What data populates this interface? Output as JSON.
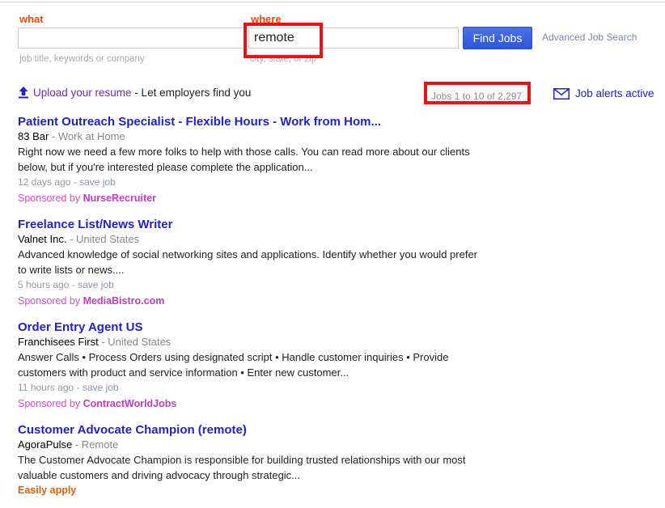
{
  "search": {
    "what_label": "what",
    "where_label": "where",
    "what_value": "",
    "what_placeholder": "",
    "where_value": "remote",
    "where_placeholder": "",
    "what_hint": "job title, keywords or company",
    "where_hint": "city, state, or zip",
    "find_jobs_label": "Find Jobs",
    "advanced_search_label": "Advanced Job Search"
  },
  "utility": {
    "upload_link": "Upload your resume",
    "upload_tail": " - Let employers find you",
    "job_count": "Jobs 1 to 10 of 2,297",
    "alerts_label": "Job alerts active"
  },
  "annotations": {
    "color": "#ee1111",
    "boxes": [
      "where-input",
      "job-count"
    ]
  },
  "results": [
    {
      "title": "Patient Outreach Specialist - Flexible Hours - Work from Hom...",
      "company": "83 Bar",
      "separator": " - ",
      "location": "Work at Home",
      "summary": "Right now we need a few more folks to help with those calls. You can read more about our clients below, but if you're interested please complete the application...",
      "age": "12 days ago",
      "footer_sep": " - ",
      "save_label": "save job",
      "sponsored_prefix": "Sponsored by ",
      "sponsored_by": "NurseRecruiter",
      "easily_apply": ""
    },
    {
      "title": "Freelance List/News Writer",
      "company": "Valnet Inc.",
      "separator": " - ",
      "location": "United States",
      "summary": "Advanced knowledge of social networking sites and applications. Identify whether you would prefer to write lists or news....",
      "age": "5 hours ago",
      "footer_sep": " - ",
      "save_label": "save job",
      "sponsored_prefix": "Sponsored by ",
      "sponsored_by": "MediaBistro.com",
      "easily_apply": ""
    },
    {
      "title": "Order Entry Agent US",
      "company": "Franchisees First",
      "separator": " - ",
      "location": "United States",
      "summary": "Answer Calls • Process Orders using designated script • Handle customer inquiries • Provide customers with product and service information • Enter new customer...",
      "age": "11 hours ago",
      "footer_sep": " - ",
      "save_label": "save job",
      "sponsored_prefix": "Sponsored by ",
      "sponsored_by": "ContractWorldJobs",
      "easily_apply": ""
    },
    {
      "title": "Customer Advocate Champion (remote)",
      "company": "AgoraPulse",
      "separator": " - ",
      "location": "Remote",
      "summary": "The Customer Advocate Champion is responsible for building trusted relationships with our most valuable customers and driving advocacy through strategic...",
      "age": "",
      "footer_sep": "",
      "save_label": "",
      "sponsored_prefix": "",
      "sponsored_by": "",
      "easily_apply": "Easily apply"
    }
  ],
  "colors": {
    "label_orange": "#ff4500",
    "title_blue": "#2222cc",
    "button_blue": "#2d55d8",
    "sponsored_magenta": "#d44ad4",
    "visited_purple": "#6f2da8",
    "annotation_red": "#ee1111"
  }
}
